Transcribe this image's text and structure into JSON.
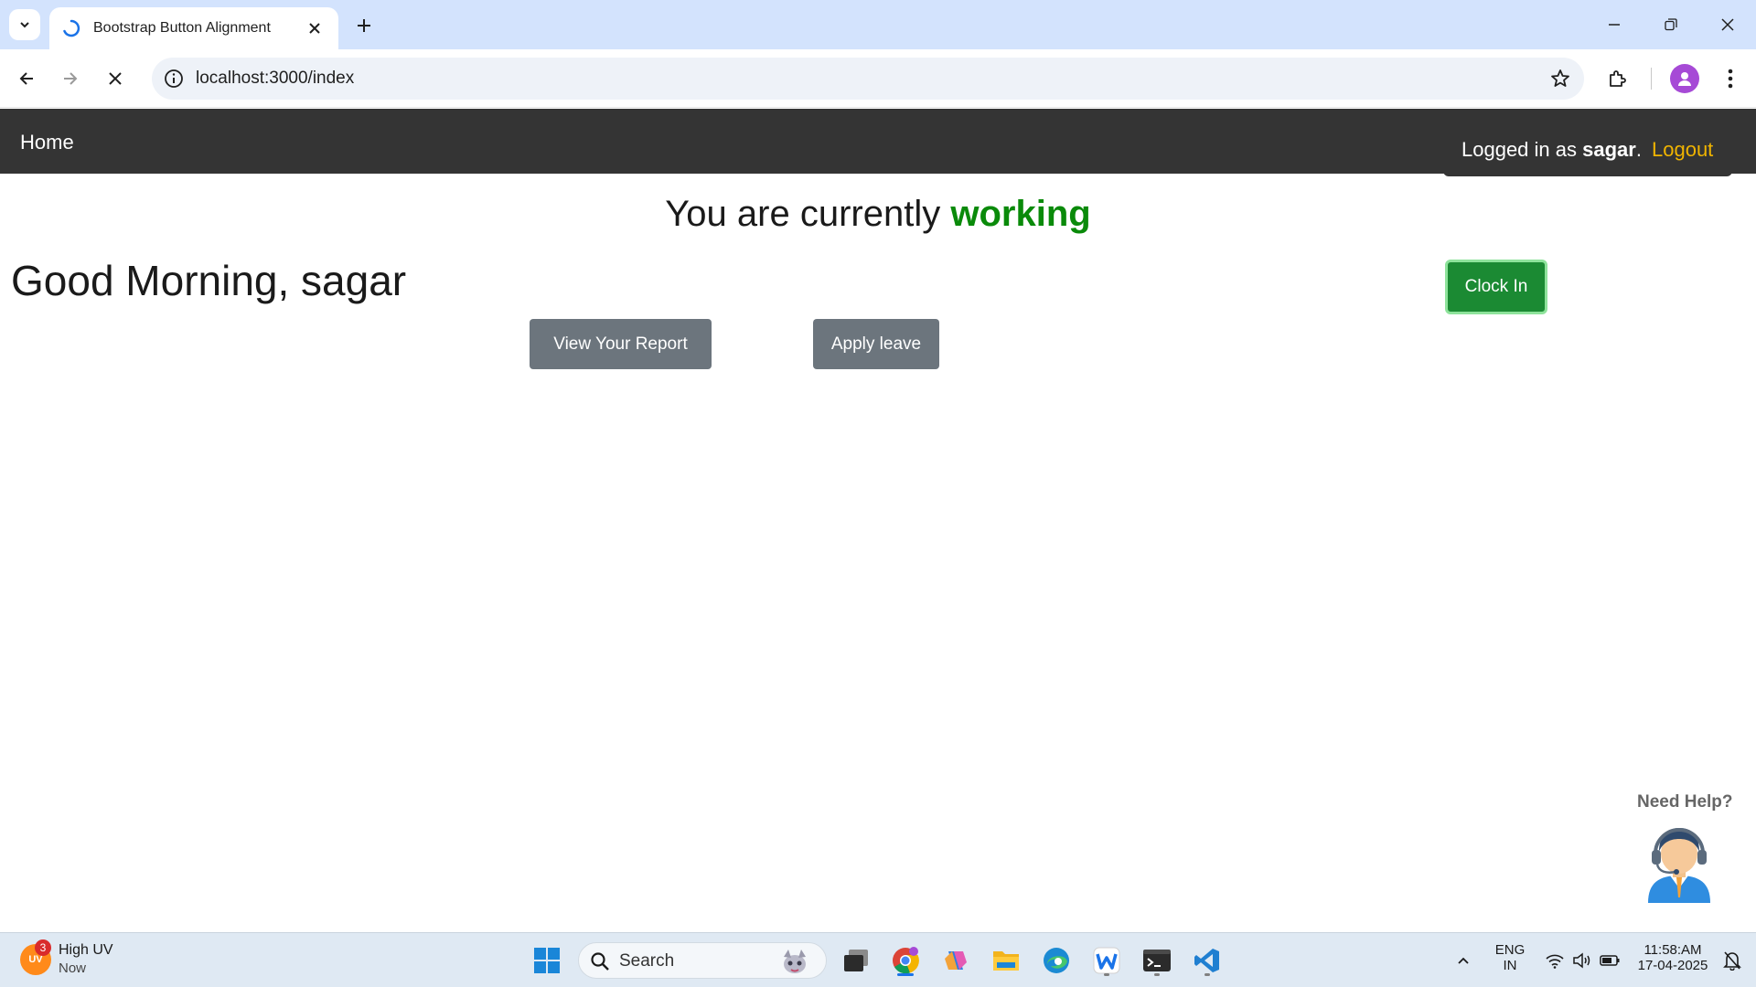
{
  "browser": {
    "tab_title": "Bootstrap Button Alignment",
    "url": "localhost:3000/index"
  },
  "navbar": {
    "home_label": "Home",
    "logged_in_prefix": "Logged in as",
    "username": "sagar",
    "logged_in_suffix": ".",
    "logout_label": "Logout"
  },
  "main": {
    "status_prefix": "You are currently",
    "status_value": "working",
    "greeting": "Good Morning, sagar",
    "view_report_label": "View Your Report",
    "apply_leave_label": "Apply leave",
    "clock_in_label": "Clock In",
    "help_label": "Need Help?"
  },
  "taskbar": {
    "weather_badge": "3",
    "weather_icon_text": "UV",
    "weather_title": "High UV",
    "weather_time": "Now",
    "search_placeholder": "Search",
    "lang_line1": "ENG",
    "lang_line2": "IN",
    "time": "11:58:AM",
    "date": "17-04-2025"
  },
  "colors": {
    "navbar_bg": "#343434",
    "working_green": "#0a8a0a",
    "logout_yellow": "#f0b400",
    "clock_in_green": "#1b8a33",
    "secondary_button": "#6c757d"
  }
}
